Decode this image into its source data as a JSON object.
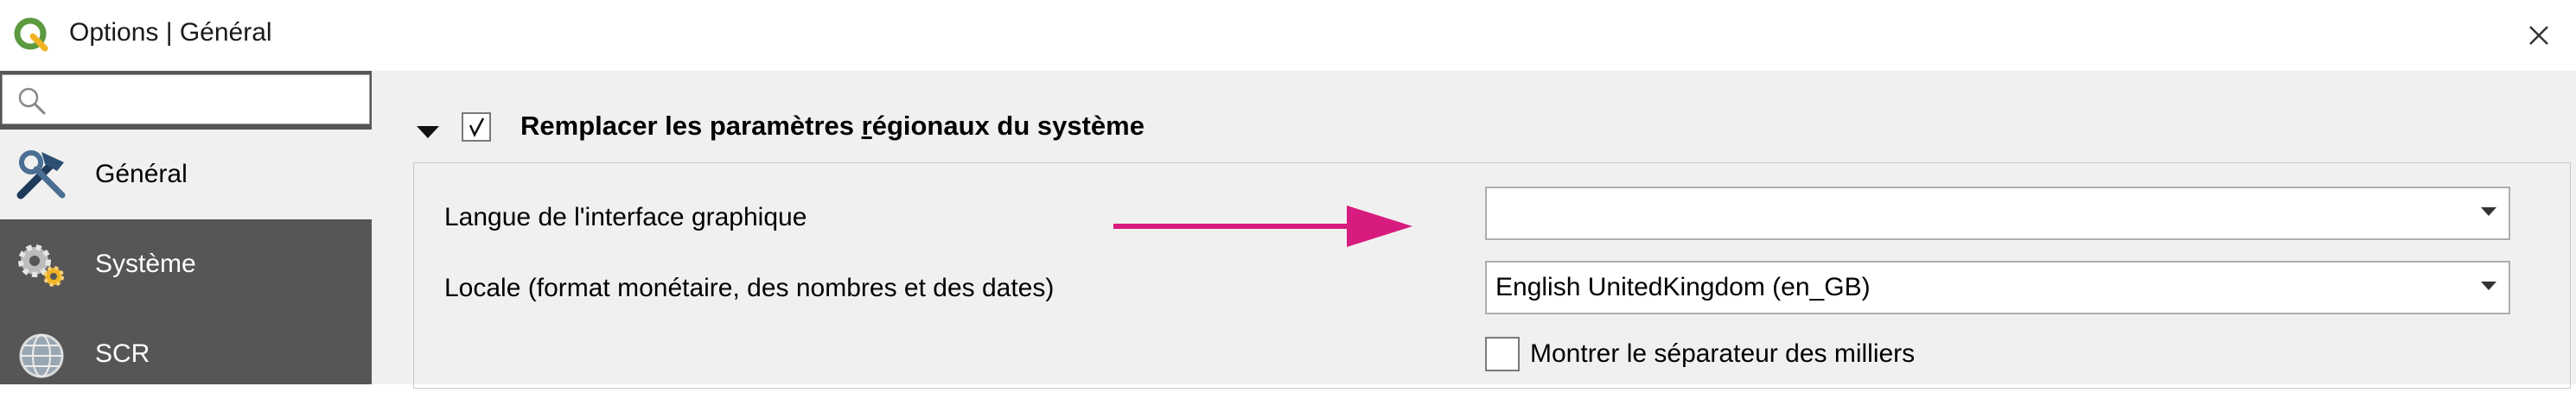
{
  "window": {
    "title": "Options | Général",
    "close_icon": "close-icon"
  },
  "sidebar": {
    "search": {
      "placeholder": "",
      "value": ""
    },
    "items": [
      {
        "label": "Général",
        "icon": "tools-hammer-wrench-icon",
        "selected": true
      },
      {
        "label": "Système",
        "icon": "gears-icon",
        "selected": false
      },
      {
        "label": "SCR",
        "icon": "globe-grid-icon",
        "selected": false
      }
    ]
  },
  "main": {
    "group": {
      "title_before": "Remplacer les paramètres ",
      "title_underlined": "r",
      "title_after": "égionaux du système",
      "expanded": true,
      "checked": true
    },
    "rows": [
      {
        "label": "Langue de l'interface graphique",
        "combo_value": ""
      },
      {
        "label": "Locale (format monétaire, des nombres et des dates)",
        "combo_value": "English UnitedKingdom (en_GB)"
      }
    ],
    "thousands_separator": {
      "label": "Montrer le séparateur des milliers",
      "checked": false
    },
    "annotation": {
      "color": "#d81b7f"
    }
  },
  "colors": {
    "sidebar_bg": "#565656",
    "selected_bg": "#f0f0f0",
    "qgis_green": "#5b9a3f",
    "qgis_yellow": "#f0b323"
  }
}
